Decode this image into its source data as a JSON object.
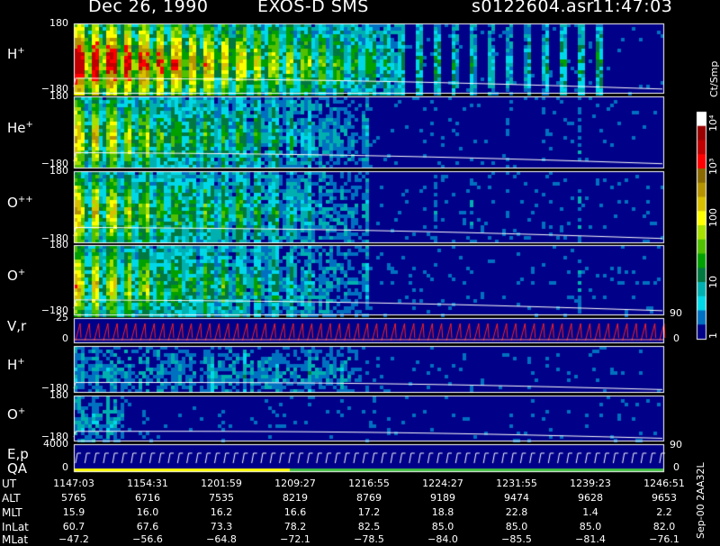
{
  "header": {
    "date": "Dec 26, 1990",
    "instrument": "EXOS-D SMS",
    "file": "s0122604.asr",
    "time": "11:47:03"
  },
  "panels": [
    {
      "label": "H",
      "sup": "+",
      "ytop": "180",
      "ybot": "-180",
      "intensity": "high"
    },
    {
      "label": "He",
      "sup": "+",
      "ytop": "180",
      "ybot": "-180",
      "intensity": "mid"
    },
    {
      "label": "O",
      "sup": "++",
      "ytop": "180",
      "ybot": "-180",
      "intensity": "mid"
    },
    {
      "label": "O",
      "sup": "+",
      "ytop": "180",
      "ybot": "-180",
      "intensity": "mid"
    },
    {
      "label": "V,r",
      "sup": "",
      "ytop": "25",
      "ybot": "0",
      "right": "90",
      "right0": "0"
    },
    {
      "label": "H",
      "sup": "+",
      "ytop": "",
      "ybot": "-180",
      "intensity": "low"
    },
    {
      "label": "O",
      "sup": "+",
      "ytop": "180",
      "ybot": "-180",
      "intensity": "low"
    },
    {
      "label": "E,p",
      "sup": "",
      "label2": "QA",
      "ytop": "4000",
      "ybot": "0",
      "right": "90",
      "right0": "0"
    }
  ],
  "colorbar": {
    "unit": "Ct/Smp",
    "ticks": [
      "10⁴",
      "10³",
      "100",
      "10",
      "1"
    ],
    "colors": [
      "#ffffff",
      "#9a0000",
      "#c00000",
      "#ff0000",
      "#8a6a00",
      "#b59300",
      "#d8c000",
      "#ffff00",
      "#a8e000",
      "#50c000",
      "#00a000",
      "#007840",
      "#00b0b0",
      "#00d8e8",
      "#0070c0",
      "#000088"
    ]
  },
  "footer": {
    "stamp": "Sep-00  2AA32L"
  },
  "ephemeris": {
    "labels": [
      "UT",
      "ALT",
      "MLT",
      "InLat",
      "MLat"
    ],
    "columns": [
      [
        "1147:03",
        "5765",
        "15.9",
        "60.7",
        "-47.2"
      ],
      [
        "1154:31",
        "6716",
        "16.0",
        "67.6",
        "-56.6"
      ],
      [
        "1201:59",
        "7535",
        "16.2",
        "73.3",
        "-64.8"
      ],
      [
        "1209:27",
        "8219",
        "16.6",
        "78.2",
        "-72.1"
      ],
      [
        "1216:55",
        "8769",
        "17.2",
        "82.5",
        "-78.5"
      ],
      [
        "1224:27",
        "9189",
        "18.8",
        "85.0",
        "-84.0"
      ],
      [
        "1231:55",
        "9474",
        "22.8",
        "85.0",
        "-85.5"
      ],
      [
        "1239:23",
        "9628",
        "1.4",
        "85.0",
        "-81.4"
      ],
      [
        "1246:51",
        "9653",
        "2.2",
        "82.0",
        "-76.1"
      ]
    ]
  },
  "chart_data": {
    "type": "heatmap",
    "title": "Dec 26, 1990   EXOS-D SMS",
    "x": [
      "1147:03",
      "1154:31",
      "1201:59",
      "1209:27",
      "1216:55",
      "1224:27",
      "1231:55",
      "1239:23",
      "1246:51"
    ],
    "colorbar_label": "Ct/Smp",
    "colorbar_ticks": [
      "1",
      "10",
      "100",
      "10³",
      "10⁴"
    ],
    "series": [
      {
        "name": "H+",
        "ylim": [
          -180,
          180
        ]
      },
      {
        "name": "He+",
        "ylim": [
          -180,
          180
        ]
      },
      {
        "name": "O++",
        "ylim": [
          -180,
          180
        ]
      },
      {
        "name": "O+",
        "ylim": [
          -180,
          180
        ]
      },
      {
        "name": "V,r",
        "ylim": [
          0,
          25
        ]
      },
      {
        "name": "H+",
        "ylim": [
          -180,
          180
        ]
      },
      {
        "name": "O+",
        "ylim": [
          -180,
          180
        ]
      },
      {
        "name": "E,p",
        "ylim": [
          0,
          4000
        ]
      }
    ]
  }
}
